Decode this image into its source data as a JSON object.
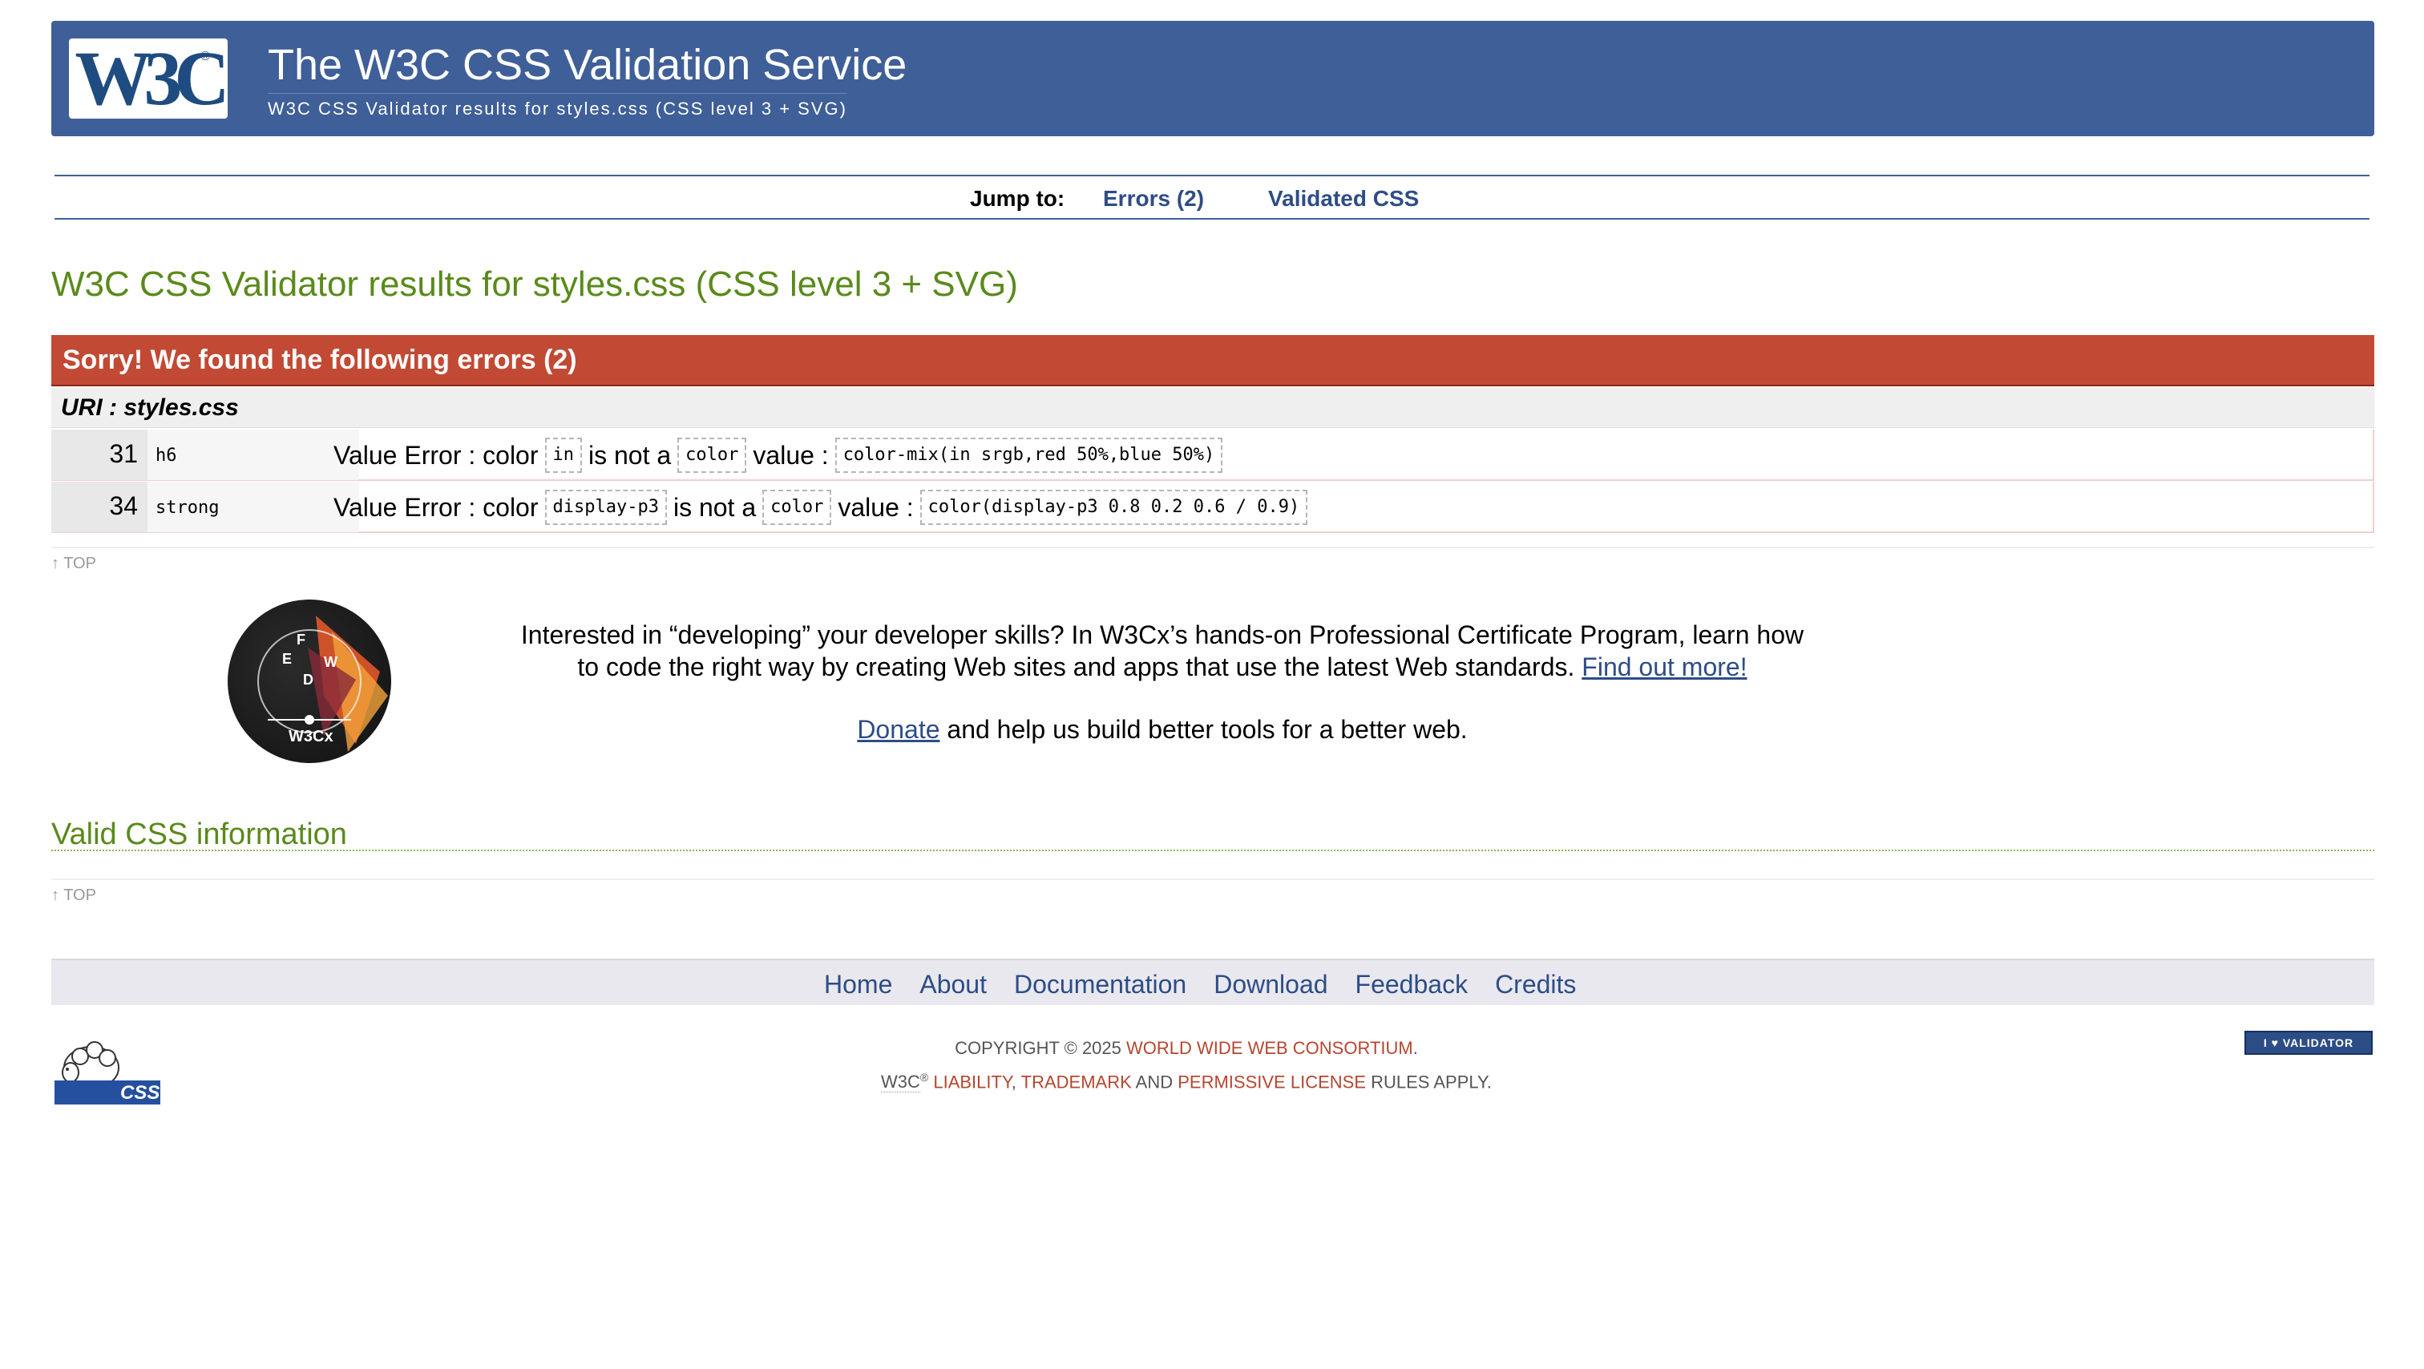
{
  "banner": {
    "logo_text": "W3C",
    "title": "The W3C CSS Validation Service",
    "subtitle": "W3C CSS Validator results for styles.css (CSS level 3 + SVG)"
  },
  "jump": {
    "label": "Jump to:",
    "errors_link": "Errors (2)",
    "validated_link": "Validated CSS"
  },
  "results_title": "W3C CSS Validator results for styles.css (CSS level 3 + SVG)",
  "errors": {
    "header": "Sorry! We found the following errors (2)",
    "uri": "URI : styles.css",
    "rows": [
      {
        "line": "31",
        "context": "h6",
        "prefix": "Value Error : color",
        "code1": "in",
        "mid": "is not a",
        "code2": "color",
        "mid2": "value :",
        "code3": "color-mix(in srgb,red 50%,blue 50%)"
      },
      {
        "line": "34",
        "context": "strong",
        "prefix": "Value Error : color",
        "code1": "display-p3",
        "mid": "is not a",
        "code2": "color",
        "mid2": "value :",
        "code3": "color(display-p3 0.8 0.2 0.6 / 0.9)"
      }
    ]
  },
  "top_link": "↑ TOP",
  "promo": {
    "text": "Interested in “developing” your developer skills? In W3Cx’s hands-on Professional Certificate Program, learn how to code the right way by creating Web sites and apps that use the latest Web standards.",
    "link": "Find out more!",
    "donate_link": "Donate",
    "donate_text": "and help us build better tools for a better web.",
    "badge_text": "W3Cx"
  },
  "valid_title": "Valid CSS information",
  "footer_nav": [
    "Home",
    "About",
    "Documentation",
    "Download",
    "Feedback",
    "Credits"
  ],
  "copyright": {
    "prefix": "COPYRIGHT © 2025",
    "org": "WORLD WIDE WEB CONSORTIUM",
    "w3c": "W3C",
    "reg": "®",
    "liability": "LIABILITY",
    "trademark": "TRADEMARK",
    "and": "AND",
    "license": "PERMISSIVE LICENSE",
    "rules": "RULES APPLY."
  },
  "sheep_badge": "CSS",
  "validator_badge": "I ♥ VALIDATOR",
  "colors": {
    "banner": "#3f5f98",
    "error_header": "#c24a34",
    "heading_green": "#5a8a1b",
    "link": "#2d4d86"
  }
}
